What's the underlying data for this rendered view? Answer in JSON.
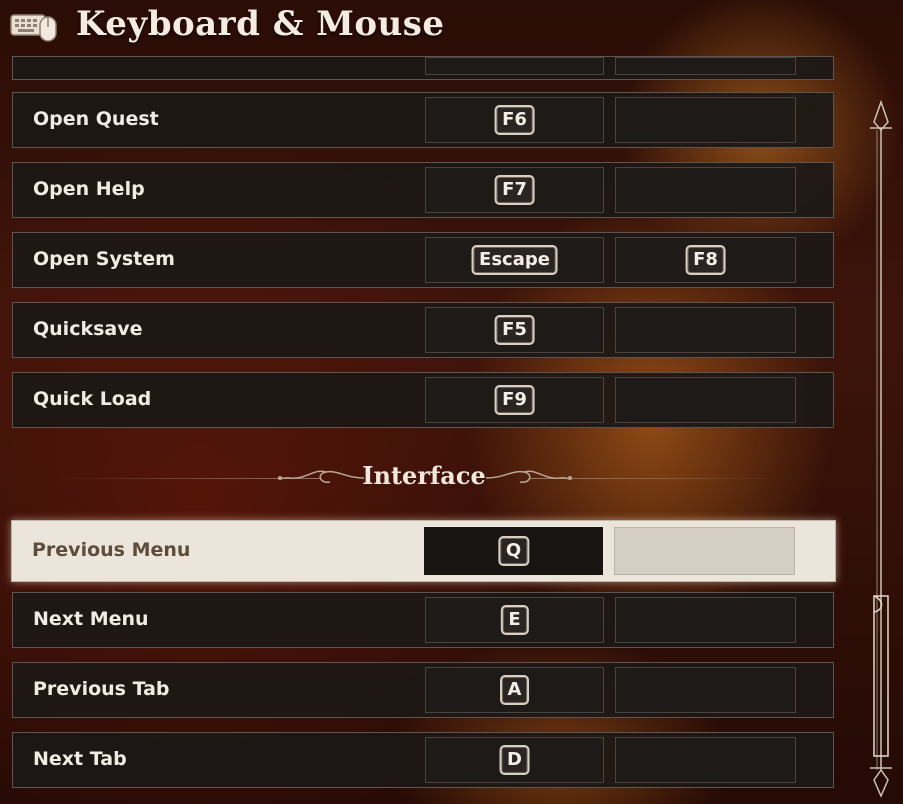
{
  "header": {
    "icon": "keyboard-mouse-icon",
    "title": "Keyboard & Mouse"
  },
  "rows_top": [
    {
      "label": "Open Quest",
      "primary": "F6",
      "secondary": ""
    },
    {
      "label": "Open Help",
      "primary": "F7",
      "secondary": ""
    },
    {
      "label": "Open System",
      "primary": "Escape",
      "secondary": "F8"
    },
    {
      "label": "Quicksave",
      "primary": "F5",
      "secondary": ""
    },
    {
      "label": "Quick Load",
      "primary": "F9",
      "secondary": ""
    }
  ],
  "section": {
    "title": "Interface"
  },
  "rows_interface": [
    {
      "label": "Previous Menu",
      "primary": "Q",
      "secondary": "",
      "selected": true
    },
    {
      "label": "Next Menu",
      "primary": "E",
      "secondary": ""
    },
    {
      "label": "Previous Tab",
      "primary": "A",
      "secondary": ""
    },
    {
      "label": "Next Tab",
      "primary": "D",
      "secondary": ""
    }
  ],
  "colors": {
    "row_bg": "#1c1816",
    "selected_bg": "#ece5db",
    "text": "#f1ebe4",
    "selected_text": "#5e4c3c"
  }
}
